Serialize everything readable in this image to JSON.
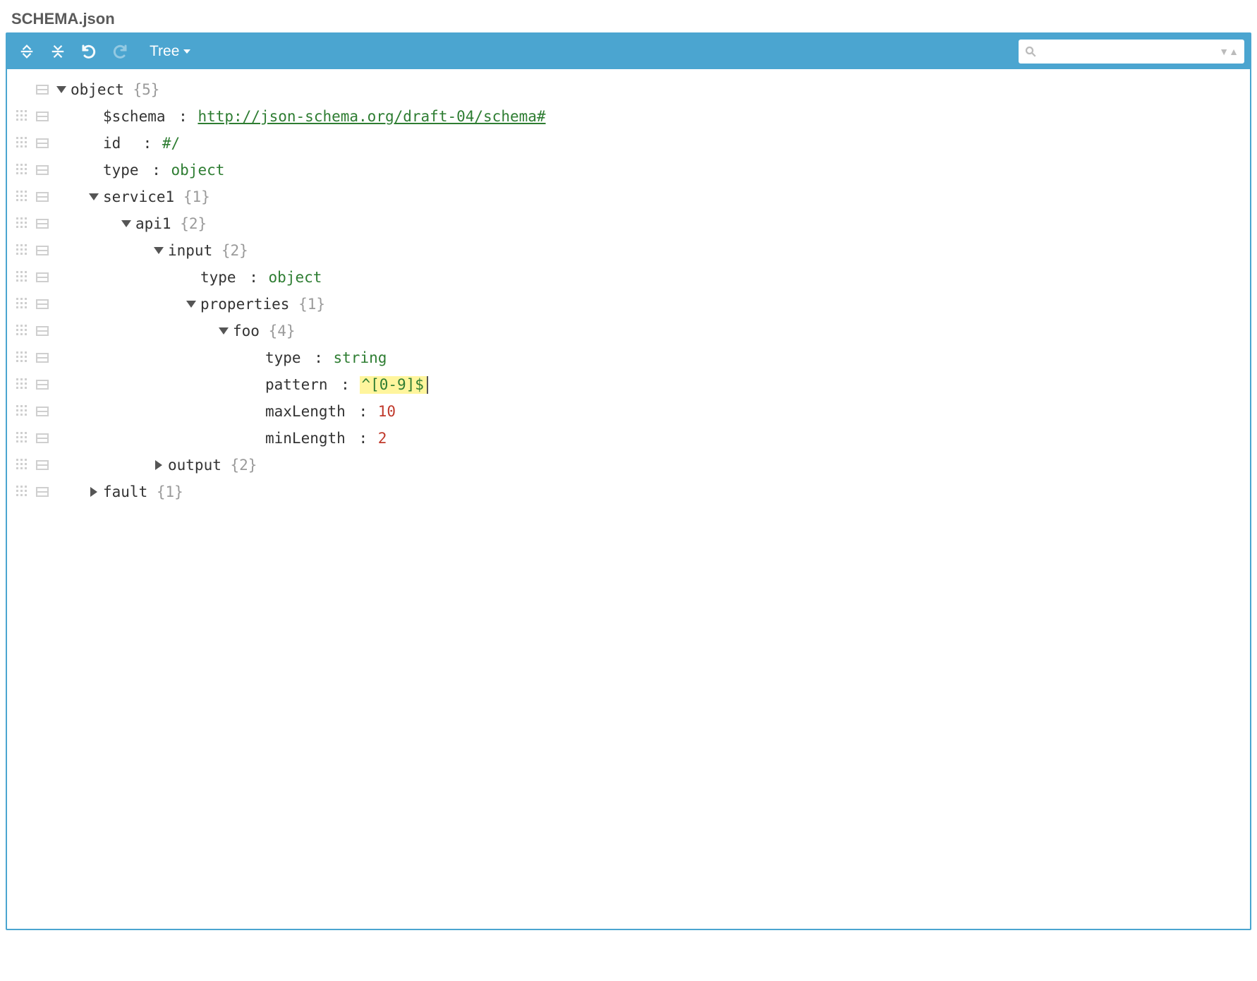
{
  "title": "SCHEMA.json",
  "toolbar": {
    "mode_label": "Tree"
  },
  "search": {
    "placeholder": ""
  },
  "rows": [
    {
      "drag": false,
      "menu": true,
      "caret": "down",
      "indent": 0,
      "key": "object",
      "count": "{5}"
    },
    {
      "drag": true,
      "menu": true,
      "caret": "",
      "indent": 1,
      "key": "$schema",
      "colon": true,
      "val": "http://json-schema.org/draft-04/schema#",
      "vtype": "link"
    },
    {
      "drag": true,
      "menu": true,
      "caret": "",
      "indent": 1,
      "key": "id ",
      "colon": true,
      "val": "#/",
      "vtype": "string"
    },
    {
      "drag": true,
      "menu": true,
      "caret": "",
      "indent": 1,
      "key": "type",
      "colon": true,
      "val": "object",
      "vtype": "string"
    },
    {
      "drag": true,
      "menu": true,
      "caret": "down",
      "indent": 1,
      "key": "service1",
      "count": "{1}"
    },
    {
      "drag": true,
      "menu": true,
      "caret": "down",
      "indent": 2,
      "key": "api1",
      "count": "{2}"
    },
    {
      "drag": true,
      "menu": true,
      "caret": "down",
      "indent": 3,
      "key": "input",
      "count": "{2}"
    },
    {
      "drag": true,
      "menu": true,
      "caret": "",
      "indent": 4,
      "key": "type",
      "colon": true,
      "val": "object",
      "vtype": "string"
    },
    {
      "drag": true,
      "menu": true,
      "caret": "down",
      "indent": 4,
      "key": "properties",
      "count": "{1}"
    },
    {
      "drag": true,
      "menu": true,
      "caret": "down",
      "indent": 5,
      "key": "foo",
      "count": "{4}"
    },
    {
      "drag": true,
      "menu": true,
      "caret": "",
      "indent": 6,
      "key": "type",
      "colon": true,
      "val": "string",
      "vtype": "string"
    },
    {
      "drag": true,
      "menu": true,
      "caret": "",
      "indent": 6,
      "key": "pattern",
      "colon": true,
      "val": "^[0-9]$",
      "vtype": "highlight"
    },
    {
      "drag": true,
      "menu": true,
      "caret": "",
      "indent": 6,
      "key": "maxLength",
      "colon": true,
      "val": "10",
      "vtype": "number"
    },
    {
      "drag": true,
      "menu": true,
      "caret": "",
      "indent": 6,
      "key": "minLength",
      "colon": true,
      "val": "2",
      "vtype": "number"
    },
    {
      "drag": true,
      "menu": true,
      "caret": "right",
      "indent": 3,
      "key": "output",
      "count": "{2}"
    },
    {
      "drag": true,
      "menu": true,
      "caret": "right",
      "indent": 1,
      "key": "fault",
      "count": "{1}"
    }
  ]
}
